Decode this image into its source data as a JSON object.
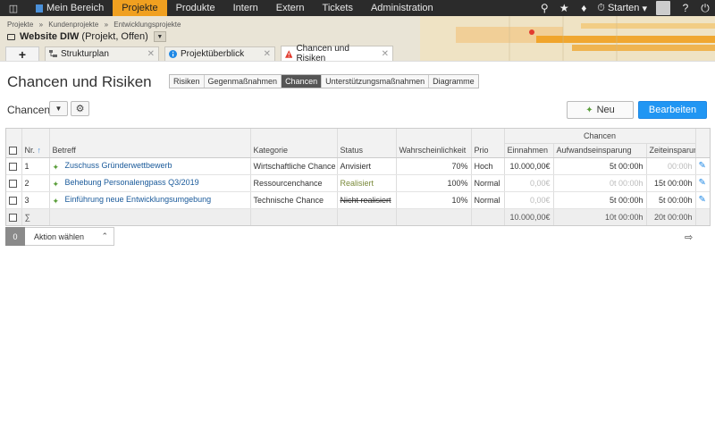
{
  "topnav": {
    "items": [
      "Mein Bereich",
      "Projekte",
      "Produkte",
      "Intern",
      "Extern",
      "Tickets",
      "Administration"
    ],
    "active_index": 1,
    "start_label": "Starten"
  },
  "breadcrumb": [
    "Projekte",
    "»",
    "Kundenprojekte",
    "»",
    "Entwicklungsprojekte"
  ],
  "project": {
    "name": "Website DIW",
    "meta": "(Projekt, Offen)"
  },
  "tabs": [
    {
      "label": "Strukturplan"
    },
    {
      "label": "Projektüberblick"
    },
    {
      "label": "Chancen und Risiken"
    }
  ],
  "page_title": "Chancen und Risiken",
  "subtabs": [
    "Risiken",
    "Gegenmaßnahmen",
    "Chancen",
    "Unterstützungsmaßnahmen",
    "Diagramme"
  ],
  "active_subtab": 2,
  "toolbar": {
    "view_label": "Chancen",
    "new_label": "Neu",
    "edit_label": "Bearbeiten"
  },
  "table": {
    "group_header": "Chancen",
    "columns": [
      "Nr.",
      "Betreff",
      "Kategorie",
      "Status",
      "Wahrscheinlichkeit",
      "Prio",
      "Einnahmen",
      "Aufwandseinsparung",
      "Zeiteinsparung"
    ],
    "rows": [
      {
        "nr": "1",
        "betreff": "Zuschuss Gründerwettbewerb",
        "kategorie": "Wirtschaftliche Chance",
        "status": "Anvisiert",
        "wahrscheinlichkeit": "70%",
        "prio": "Hoch",
        "einnahmen": "10.000,00€",
        "aufwand": "5t 00:00h",
        "zeit": "00:00h"
      },
      {
        "nr": "2",
        "betreff": "Behebung Personalengpass Q3/2019",
        "kategorie": "Ressourcenchance",
        "status": "Realisiert",
        "wahrscheinlichkeit": "100%",
        "prio": "Normal",
        "einnahmen": "0,00€",
        "aufwand": "0t 00:00h",
        "zeit": "15t 00:00h"
      },
      {
        "nr": "3",
        "betreff": "Einführung neue Entwicklungsumgebung",
        "kategorie": "Technische Chance",
        "status": "Nicht realisiert",
        "wahrscheinlichkeit": "10%",
        "prio": "Normal",
        "einnahmen": "0,00€",
        "aufwand": "5t 00:00h",
        "zeit": "5t 00:00h"
      }
    ],
    "footer": {
      "sum_symbol": "∑",
      "einnahmen": "10.000,00€",
      "aufwand": "10t 00:00h",
      "zeit": "20t 00:00h"
    }
  },
  "actionbar": {
    "count": "0",
    "label": "Aktion wählen"
  },
  "colors": {
    "accent": "#f0a020",
    "primary_button": "#2196f3",
    "nav_bg": "#2b2b2b",
    "link": "#1a5a9a"
  }
}
